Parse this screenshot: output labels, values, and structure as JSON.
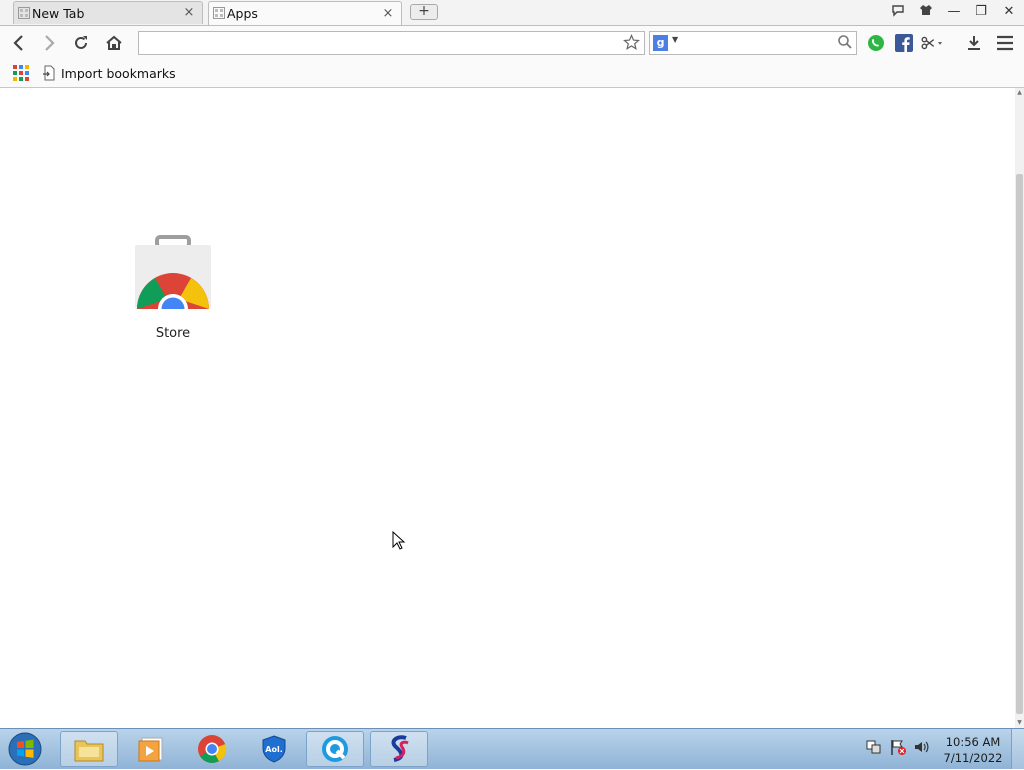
{
  "tabs": [
    {
      "title": "New Tab",
      "close": "×",
      "active": false
    },
    {
      "title": "Apps",
      "close": "×",
      "active": true
    }
  ],
  "new_tab_symbol": "+",
  "window_controls": {
    "minimize": "—",
    "restore": "❐",
    "close": "✕"
  },
  "omnibox": {
    "value": "",
    "placeholder": ""
  },
  "search_box": {
    "engine_letter": "g",
    "value": "",
    "placeholder": ""
  },
  "bookmarks_bar": {
    "import_label": "Import bookmarks"
  },
  "apps": [
    {
      "label": "Store",
      "icon": "chrome-web-store-icon"
    }
  ],
  "taskbar": {
    "clock_time": "10:56 AM",
    "clock_date": "7/11/2022",
    "items": [
      "windows-explorer-icon",
      "media-player-icon",
      "chrome-icon",
      "aol-shield-icon",
      "q-app-icon",
      "s-app-icon"
    ]
  },
  "colors": {
    "accent_blue": "#4c7ee6",
    "chrome_red": "#db4437",
    "chrome_yellow": "#f4c20d",
    "chrome_green": "#0f9d58",
    "taskbar": "#a4c2e0"
  }
}
